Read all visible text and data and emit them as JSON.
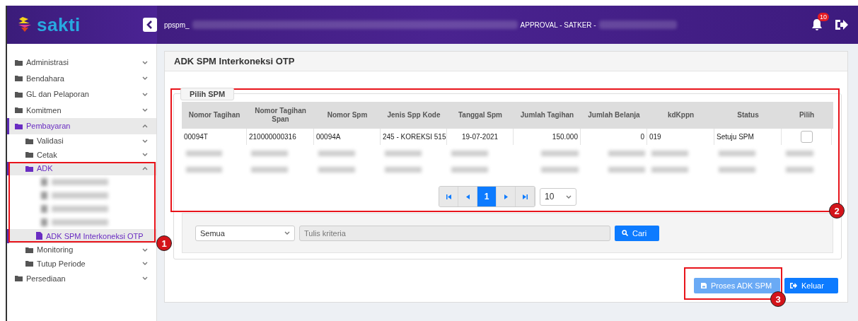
{
  "header": {
    "logo": "sakti",
    "user_prefix": "ppspm_",
    "role": "APPROVAL - SATKER -",
    "notifications": "10"
  },
  "sidebar": {
    "items": [
      {
        "label": "Administrasi",
        "expanded": false,
        "selected": false
      },
      {
        "label": "Bendahara",
        "expanded": false,
        "selected": false
      },
      {
        "label": "GL dan Pelaporan",
        "expanded": false,
        "selected": false
      },
      {
        "label": "Komitmen",
        "expanded": false,
        "selected": false
      },
      {
        "label": "Pembayaran",
        "expanded": true,
        "selected": true,
        "children": [
          {
            "label": "Validasi",
            "expanded": false,
            "selected": false
          },
          {
            "label": "Cetak",
            "expanded": false,
            "selected": false
          },
          {
            "label": "ADK",
            "expanded": true,
            "selected": true,
            "children": [
              {
                "kind": "redacted"
              },
              {
                "kind": "redacted"
              },
              {
                "kind": "redacted"
              },
              {
                "kind": "redacted"
              },
              {
                "kind": "page",
                "label": "ADK SPM Interkoneksi OTP",
                "selected": true
              }
            ]
          },
          {
            "label": "Monitoring",
            "expanded": false,
            "selected": false
          },
          {
            "label": "Tutup Periode",
            "expanded": false,
            "selected": false
          }
        ]
      },
      {
        "label": "Persediaan",
        "expanded": false,
        "selected": false
      }
    ]
  },
  "page": {
    "title": "ADK SPM Interkoneksi OTP",
    "legend": "Pilih SPM"
  },
  "table": {
    "columns": [
      "Nomor Tagihan",
      "Nomor Tagihan Span",
      "Nomor Spm",
      "Jenis Spp Kode",
      "Tanggal Spm",
      "Jumlah Tagihan",
      "Jumlah Belanja",
      "kdKppn",
      "Status",
      "Pilih"
    ],
    "rows": [
      {
        "kind": "data",
        "cells": [
          "00094T",
          "210000000316",
          "00094A",
          "245 - KOREKSI 515",
          "19-07-2021",
          "150.000",
          "0",
          "019",
          "Setuju SPM"
        ],
        "checked": false
      },
      {
        "kind": "redacted"
      },
      {
        "kind": "redacted"
      }
    ]
  },
  "pagination": {
    "pages": [
      {
        "label": "1",
        "selected": true
      }
    ],
    "page_size": "10"
  },
  "search": {
    "filter": "Semua",
    "placeholder": "Tulis kriteria",
    "button": "Cari"
  },
  "actions": [
    {
      "label": "Proses ADK SPM",
      "kind": "save",
      "disabled": true
    },
    {
      "label": "Keluar",
      "kind": "exit",
      "disabled": false
    }
  ],
  "callouts": [
    "1",
    "2",
    "3"
  ]
}
